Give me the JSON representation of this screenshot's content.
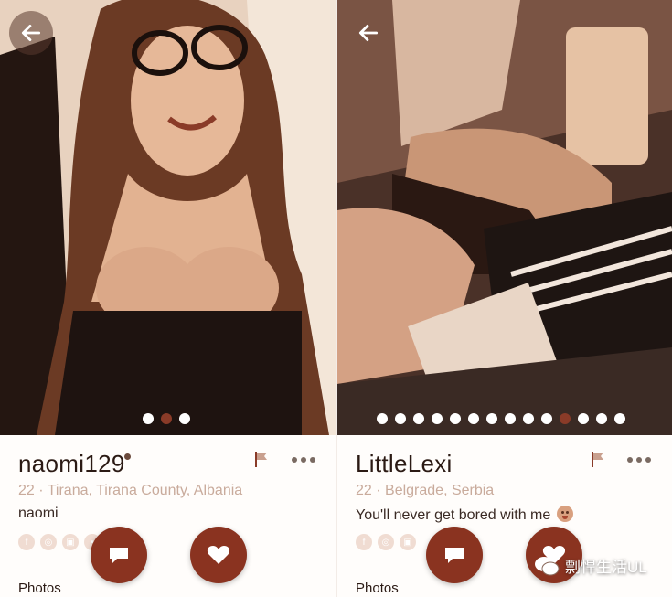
{
  "colors": {
    "accent": "#8a3320",
    "active_dot": "#8a3b28",
    "location_text": "#c9ab9c",
    "name_text": "#2b1a14"
  },
  "profiles": [
    {
      "username": "naomi129",
      "online": true,
      "location": "22 · Tirana, Tirana County, Albania",
      "bio": "naomi",
      "photo_count": 3,
      "active_photo_index": 1,
      "icons": {
        "back": "arrow-left-icon",
        "report": "flag-icon",
        "more": "more-horizontal-icon",
        "message": "chat-bubble-icon",
        "like": "heart-icon"
      },
      "social": [
        "facebook-icon",
        "instagram-icon",
        "linkedin-icon",
        "other-icon"
      ],
      "section_label": "Photos"
    },
    {
      "username": "LittleLexi",
      "online": false,
      "location": "22 · Belgrade, Serbia",
      "bio": "You'll never get bored with me",
      "bio_emoji": "tongue-out-emoji",
      "photo_count": 14,
      "active_photo_index": 10,
      "icons": {
        "back": "arrow-left-icon",
        "report": "flag-icon",
        "more": "more-horizontal-icon",
        "message": "chat-bubble-icon",
        "like": "heart-icon"
      },
      "social": [
        "facebook-icon",
        "instagram-icon",
        "linkedin-icon"
      ],
      "section_label": "Photos"
    }
  ],
  "watermark": {
    "text": "剽悍生活UL",
    "logo": "wechat-logo"
  }
}
